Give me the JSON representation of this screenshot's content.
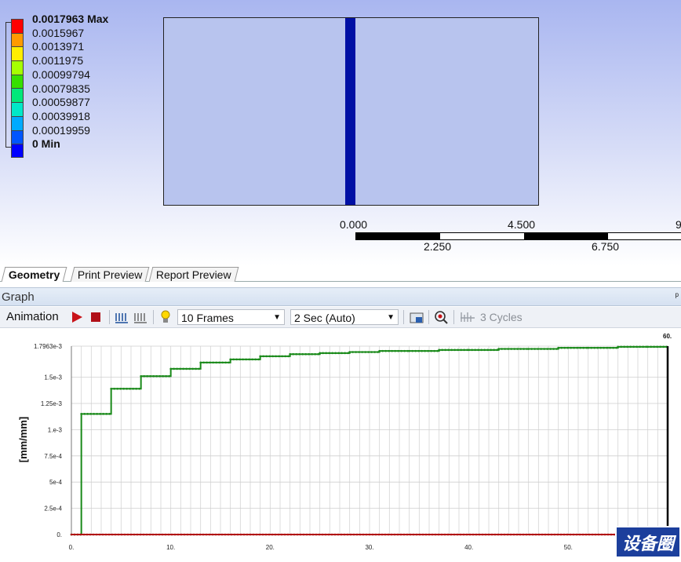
{
  "viewport": {
    "legend": [
      {
        "label": "0.0017963 Max",
        "color": "#ff0000",
        "bold": true
      },
      {
        "label": "0.0015967",
        "color": "#ff9a00",
        "bold": false
      },
      {
        "label": "0.0013971",
        "color": "#ffee00",
        "bold": false
      },
      {
        "label": "0.0011975",
        "color": "#a6ff00",
        "bold": false
      },
      {
        "label": "0.00099794",
        "color": "#36e000",
        "bold": false
      },
      {
        "label": "0.00079835",
        "color": "#00e87a",
        "bold": false
      },
      {
        "label": "0.00059877",
        "color": "#00e8c8",
        "bold": false
      },
      {
        "label": "0.00039918",
        "color": "#00aaff",
        "bold": false
      },
      {
        "label": "0.00019959",
        "color": "#0055ff",
        "bold": false
      },
      {
        "label": "0 Min",
        "color": "#0000ff",
        "bold": true
      }
    ],
    "beam_color": "#0010a4",
    "scale": {
      "top_labels": [
        "0.000",
        "4.500",
        "9"
      ],
      "bottom_labels": [
        "2.250",
        "6.750"
      ]
    }
  },
  "tabs": [
    {
      "label": "Geometry",
      "active": true
    },
    {
      "label": "Print Preview",
      "active": false
    },
    {
      "label": "Report Preview",
      "active": false
    }
  ],
  "graph_panel": {
    "title": "Graph",
    "pin": "ᵖ"
  },
  "toolbar": {
    "animation_label": "Animation",
    "frames": "10 Frames",
    "speed": "2 Sec (Auto)",
    "cycles": "3 Cycles"
  },
  "watermark": "设备圈",
  "chart_data": {
    "type": "line",
    "ylabel": "[mm/mm]",
    "xlim": [
      0,
      60
    ],
    "ylim": [
      0,
      0.0017963
    ],
    "x_ticks": [
      "0.",
      "10.",
      "20.",
      "30.",
      "40.",
      "50."
    ],
    "y_ticks": [
      "0.",
      "2.5e-4",
      "5e-4",
      "7.5e-4",
      "1.e-3",
      "1.25e-3",
      "1.5e-3",
      "1.7963e-3"
    ],
    "end_marker_label": "60.",
    "series": [
      {
        "color": "#1a8a1a",
        "x": [
          0,
          0.9,
          1.0,
          4.0,
          7.0,
          10.0,
          13.0,
          16.0,
          19.0,
          22.0,
          25.0,
          28.0,
          31.0,
          34.0,
          37.0,
          40.0,
          43.0,
          46.0,
          49.0,
          52.0,
          55.0,
          58.0,
          60.0
        ],
        "values": [
          0,
          0,
          0.00115,
          0.00139,
          0.00151,
          0.00158,
          0.00164,
          0.00167,
          0.0017,
          0.00172,
          0.00173,
          0.00174,
          0.00175,
          0.00175,
          0.00176,
          0.00176,
          0.00177,
          0.00177,
          0.00178,
          0.00178,
          0.00179,
          0.00179,
          0.0017963
        ]
      },
      {
        "color": "#b01010",
        "x": [
          0,
          60
        ],
        "values": [
          0,
          0
        ]
      }
    ]
  }
}
